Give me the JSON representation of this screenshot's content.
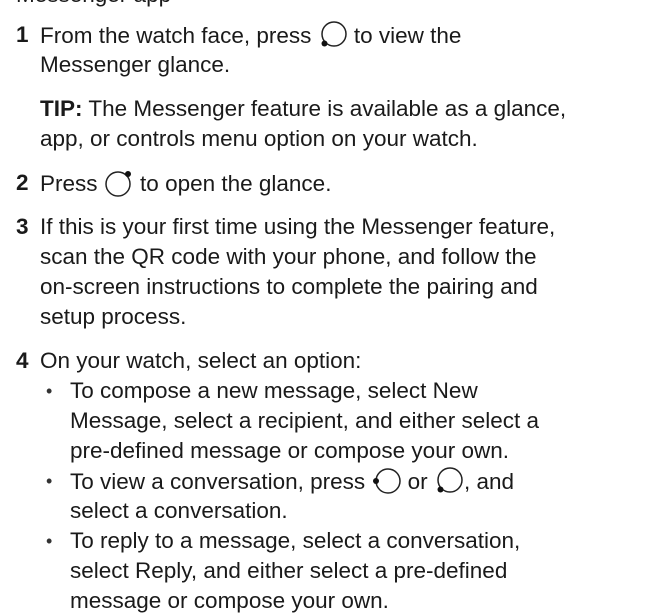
{
  "header_fragment": "Messenger app",
  "steps": [
    {
      "number": "1",
      "line1_pre": "From the watch face, press",
      "line1_icon": "watch-button-bottom-left-icon",
      "line1_post": "to view the",
      "line2": "Messenger glance."
    },
    {
      "tip_label": "TIP:",
      "tip_line1_rest": "The Messenger feature is available as a glance,",
      "tip_line2": "app, or controls menu option on your watch."
    },
    {
      "number": "2",
      "line1_pre": "Press",
      "line1_icon": "watch-button-top-right-icon",
      "line1_post": "to open the glance."
    },
    {
      "number": "3",
      "lines": [
        "If this is your first time using the Messenger feature,",
        "scan the QR code with your phone, and follow the",
        "on-screen instructions to complete the pairing and",
        "setup process."
      ]
    },
    {
      "number": "4",
      "line1": "On your watch, select an option:",
      "bullets": [
        {
          "lines": [
            "To compose a new message, select New",
            "Message, select a recipient, and either select a",
            "pre-defined message or compose your own."
          ]
        },
        {
          "line1_pre": "To view a conversation, press",
          "icon_a": "watch-button-middle-left-icon",
          "line1_mid": "or",
          "icon_b": "watch-button-bottom-left-icon",
          "line1_post": ", and",
          "line2": "select a conversation."
        },
        {
          "lines": [
            "To reply to a message, select a conversation,",
            "select Reply, and either select a pre-defined",
            "message or compose your own."
          ]
        }
      ]
    }
  ],
  "bullet_char": "•",
  "colors": {
    "text": "#1a1a1a"
  }
}
